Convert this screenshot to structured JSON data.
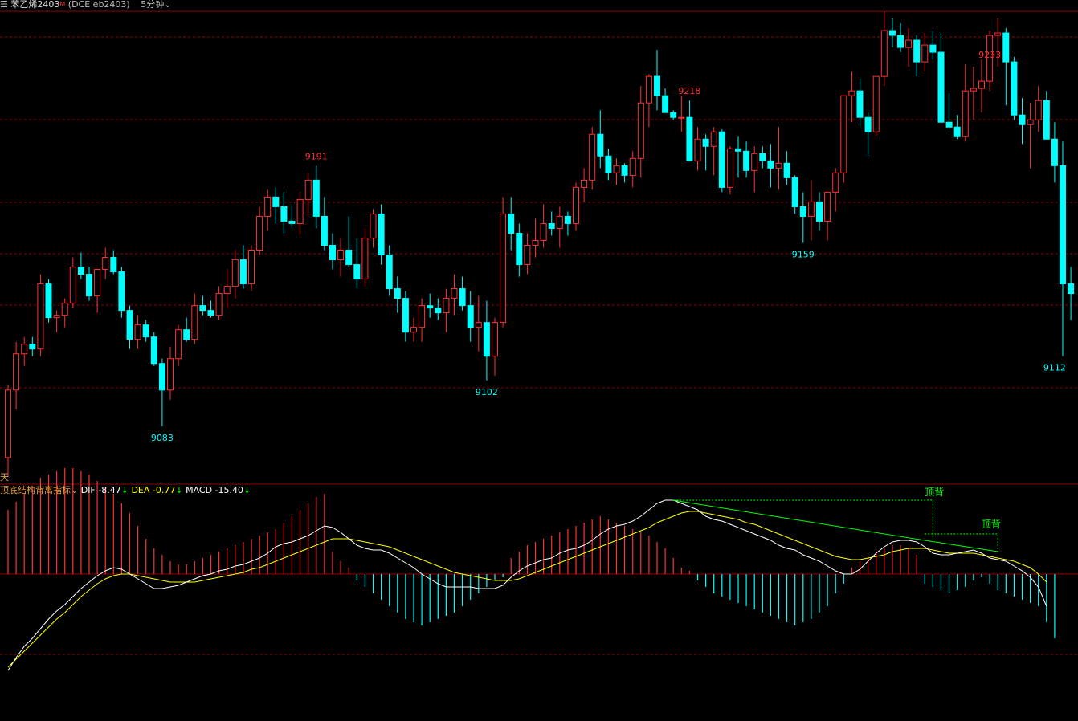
{
  "header": {
    "instrument": "苯乙烯2403",
    "mark": "M",
    "exchange_code": "(DCE  eb2403)",
    "period": "5分钟"
  },
  "days_label": "天",
  "macd_panel": {
    "indicator_name": "顶底结构背离指标",
    "dif_label": "DIF -8.47",
    "dea_label": "DEA -0.77",
    "macd_label": "MACD -15.40",
    "down_arrow": "↓",
    "annotation_1": "顶背",
    "annotation_2": "顶背"
  },
  "colors": {
    "up": "#ff3232",
    "down": "#00ffff",
    "grid": "#8b0000",
    "dif": "#ffffff",
    "dea": "#ffff00",
    "divergence": "#00ff00"
  },
  "chart_data": {
    "type": "candlestick",
    "ylim": [
      9060,
      9255
    ],
    "price_labels": [
      {
        "index": 38,
        "value": 9191,
        "kind": "high"
      },
      {
        "index": 84,
        "value": 9218,
        "kind": "high"
      },
      {
        "index": 121,
        "value": 9233,
        "kind": "high"
      },
      {
        "index": 19,
        "value": 9083,
        "kind": "low"
      },
      {
        "index": 59,
        "value": 9102,
        "kind": "low"
      },
      {
        "index": 98,
        "value": 9159,
        "kind": "low"
      },
      {
        "index": 129,
        "value": 9112,
        "kind": "low"
      }
    ],
    "candles": [
      [
        9070,
        9100,
        9062,
        9098
      ],
      [
        9098,
        9118,
        9090,
        9113
      ],
      [
        9113,
        9120,
        9108,
        9117
      ],
      [
        9117,
        9120,
        9112,
        9115
      ],
      [
        9115,
        9146,
        9112,
        9142
      ],
      [
        9142,
        9144,
        9126,
        9128
      ],
      [
        9128,
        9131,
        9122,
        9129
      ],
      [
        9129,
        9136,
        9124,
        9134
      ],
      [
        9134,
        9153,
        9132,
        9149
      ],
      [
        9149,
        9155,
        9144,
        9146
      ],
      [
        9146,
        9149,
        9135,
        9137
      ],
      [
        9137,
        9148,
        9130,
        9148
      ],
      [
        9148,
        9157,
        9144,
        9153
      ],
      [
        9153,
        9156,
        9146,
        9147
      ],
      [
        9147,
        9149,
        9128,
        9131
      ],
      [
        9131,
        9133,
        9115,
        9119
      ],
      [
        9119,
        9129,
        9115,
        9125
      ],
      [
        9125,
        9127,
        9118,
        9120
      ],
      [
        9120,
        9122,
        9108,
        9109
      ],
      [
        9109,
        9111,
        9083,
        9098
      ],
      [
        9098,
        9116,
        9094,
        9111
      ],
      [
        9111,
        9125,
        9108,
        9123
      ],
      [
        9123,
        9128,
        9118,
        9119
      ],
      [
        9119,
        9138,
        9117,
        9133
      ],
      [
        9133,
        9137,
        9129,
        9131
      ],
      [
        9131,
        9135,
        9128,
        9129
      ],
      [
        9129,
        9141,
        9127,
        9138
      ],
      [
        9138,
        9148,
        9132,
        9141
      ],
      [
        9141,
        9156,
        9136,
        9152
      ],
      [
        9152,
        9158,
        9140,
        9142
      ],
      [
        9142,
        9158,
        9139,
        9156
      ],
      [
        9156,
        9174,
        9154,
        9170
      ],
      [
        9170,
        9181,
        9164,
        9178
      ],
      [
        9178,
        9182,
        9167,
        9174
      ],
      [
        9174,
        9180,
        9163,
        9168
      ],
      [
        9168,
        9175,
        9165,
        9167
      ],
      [
        9167,
        9180,
        9162,
        9177
      ],
      [
        9177,
        9188,
        9170,
        9185
      ],
      [
        9185,
        9191,
        9165,
        9170
      ],
      [
        9170,
        9178,
        9156,
        9158
      ],
      [
        9158,
        9163,
        9148,
        9152
      ],
      [
        9152,
        9161,
        9145,
        9156
      ],
      [
        9156,
        9170,
        9149,
        9150
      ],
      [
        9150,
        9161,
        9140,
        9144
      ],
      [
        9144,
        9165,
        9141,
        9161
      ],
      [
        9161,
        9173,
        9157,
        9171
      ],
      [
        9171,
        9175,
        9150,
        9154
      ],
      [
        9154,
        9158,
        9137,
        9140
      ],
      [
        9140,
        9145,
        9130,
        9136
      ],
      [
        9136,
        9139,
        9118,
        9122
      ],
      [
        9122,
        9128,
        9118,
        9124
      ],
      [
        9124,
        9136,
        9118,
        9133
      ],
      [
        9133,
        9138,
        9128,
        9132
      ],
      [
        9132,
        9136,
        9127,
        9130
      ],
      [
        9130,
        9140,
        9122,
        9136
      ],
      [
        9136,
        9146,
        9129,
        9140
      ],
      [
        9140,
        9145,
        9131,
        9133
      ],
      [
        9133,
        9139,
        9118,
        9124
      ],
      [
        9124,
        9137,
        9114,
        9126
      ],
      [
        9126,
        9135,
        9102,
        9112
      ],
      [
        9112,
        9128,
        9104,
        9126
      ],
      [
        9126,
        9178,
        9124,
        9171
      ],
      [
        9171,
        9178,
        9156,
        9163
      ],
      [
        9163,
        9167,
        9145,
        9150
      ],
      [
        9150,
        9163,
        9146,
        9158
      ],
      [
        9158,
        9169,
        9153,
        9160
      ],
      [
        9160,
        9175,
        9157,
        9167
      ],
      [
        9167,
        9172,
        9162,
        9165
      ],
      [
        9165,
        9174,
        9157,
        9170
      ],
      [
        9170,
        9172,
        9162,
        9167
      ],
      [
        9167,
        9184,
        9164,
        9182
      ],
      [
        9182,
        9190,
        9176,
        9185
      ],
      [
        9185,
        9207,
        9181,
        9204
      ],
      [
        9204,
        9214,
        9190,
        9195
      ],
      [
        9195,
        9198,
        9185,
        9188
      ],
      [
        9188,
        9194,
        9183,
        9191
      ],
      [
        9191,
        9192,
        9184,
        9187
      ],
      [
        9187,
        9197,
        9182,
        9194
      ],
      [
        9194,
        9224,
        9186,
        9217
      ],
      [
        9217,
        9229,
        9207,
        9228
      ],
      [
        9228,
        9239,
        9214,
        9220
      ],
      [
        9220,
        9223,
        9213,
        9213
      ],
      [
        9213,
        9214,
        9210,
        9211
      ],
      [
        9211,
        9220,
        9205,
        9211
      ],
      [
        9211,
        9218,
        9200,
        9193
      ],
      [
        9193,
        9207,
        9189,
        9202
      ],
      [
        9202,
        9204,
        9189,
        9199
      ],
      [
        9199,
        9207,
        9187,
        9205
      ],
      [
        9205,
        9206,
        9180,
        9182
      ],
      [
        9182,
        9199,
        9179,
        9198
      ],
      [
        9198,
        9203,
        9186,
        9197
      ],
      [
        9197,
        9201,
        9186,
        9189
      ],
      [
        9189,
        9199,
        9180,
        9196
      ],
      [
        9196,
        9199,
        9190,
        9193
      ],
      [
        9193,
        9200,
        9182,
        9190
      ],
      [
        9190,
        9207,
        9181,
        9192
      ],
      [
        9192,
        9197,
        9183,
        9186
      ],
      [
        9186,
        9187,
        9171,
        9174
      ],
      [
        9174,
        9180,
        9159,
        9170
      ],
      [
        9170,
        9185,
        9160,
        9176
      ],
      [
        9176,
        9180,
        9164,
        9168
      ],
      [
        9168,
        9180,
        9160,
        9180
      ],
      [
        9180,
        9190,
        9172,
        9188
      ],
      [
        9188,
        9209,
        9184,
        9220
      ],
      [
        9220,
        9230,
        9209,
        9222
      ],
      [
        9222,
        9227,
        9207,
        9211
      ],
      [
        9211,
        9213,
        9195,
        9205
      ],
      [
        9205,
        9228,
        9203,
        9228
      ],
      [
        9228,
        9255,
        9224,
        9247
      ],
      [
        9247,
        9252,
        9240,
        9245
      ],
      [
        9245,
        9250,
        9238,
        9240
      ],
      [
        9240,
        9248,
        9232,
        9243
      ],
      [
        9243,
        9245,
        9228,
        9234
      ],
      [
        9234,
        9246,
        9230,
        9241
      ],
      [
        9241,
        9247,
        9235,
        9238
      ],
      [
        9238,
        9246,
        9209,
        9209
      ],
      [
        9209,
        9221,
        9206,
        9207
      ],
      [
        9207,
        9212,
        9202,
        9203
      ],
      [
        9203,
        9233,
        9201,
        9222
      ],
      [
        9222,
        9232,
        9210,
        9223
      ],
      [
        9223,
        9235,
        9213,
        9226
      ],
      [
        9226,
        9247,
        9222,
        9245
      ],
      [
        9245,
        9252,
        9232,
        9246
      ],
      [
        9246,
        9248,
        9216,
        9234
      ],
      [
        9234,
        9236,
        9210,
        9212
      ],
      [
        9212,
        9219,
        9200,
        9208
      ],
      [
        9208,
        9217,
        9190,
        9210
      ],
      [
        9210,
        9224,
        9205,
        9218
      ],
      [
        9218,
        9222,
        9202,
        9202
      ],
      [
        9202,
        9209,
        9184,
        9191
      ],
      [
        9191,
        9201,
        9112,
        9142
      ],
      [
        9142,
        9149,
        9127,
        9138
      ]
    ],
    "macd": {
      "dif": [
        -60,
        -52,
        -45,
        -40,
        -34,
        -28,
        -23,
        -19,
        -14,
        -9,
        -5,
        -1,
        2,
        4,
        3,
        0,
        -3,
        -6,
        -9,
        -9,
        -8,
        -7,
        -5,
        -3,
        -1,
        0,
        2,
        3,
        5,
        6,
        8,
        10,
        13,
        17,
        19,
        20,
        22,
        24,
        27,
        30,
        29,
        26,
        22,
        18,
        16,
        15,
        15,
        13,
        10,
        7,
        4,
        0,
        -3,
        -6,
        -8,
        -8,
        -8,
        -8,
        -9,
        -9,
        -9,
        -7,
        -2,
        2,
        5,
        7,
        9,
        10,
        13,
        15,
        16,
        18,
        21,
        25,
        28,
        30,
        31,
        33,
        36,
        40,
        44,
        46,
        46,
        44,
        42,
        40,
        36,
        34,
        33,
        31,
        29,
        27,
        25,
        23,
        21,
        18,
        16,
        15,
        12,
        10,
        8,
        5,
        2,
        0,
        0,
        3,
        8,
        13,
        17,
        20,
        21,
        21,
        20,
        17,
        13,
        12,
        12,
        13,
        14,
        15,
        13,
        10,
        9,
        8,
        5,
        2,
        -2,
        -8,
        -20
      ],
      "dea": [
        -58,
        -53,
        -48,
        -43,
        -38,
        -33,
        -28,
        -24,
        -19,
        -14,
        -10,
        -6,
        -3,
        -1,
        0,
        0,
        -1,
        -2,
        -3,
        -4,
        -5,
        -5,
        -5,
        -5,
        -4,
        -3,
        -2,
        -1,
        0,
        1,
        3,
        4,
        6,
        8,
        10,
        12,
        14,
        16,
        18,
        20,
        22,
        22,
        22,
        21,
        20,
        19,
        18,
        17,
        15,
        13,
        11,
        9,
        7,
        5,
        3,
        1,
        0,
        -1,
        -2,
        -3,
        -4,
        -4,
        -4,
        -3,
        -1,
        1,
        3,
        5,
        7,
        9,
        11,
        13,
        15,
        17,
        19,
        21,
        23,
        25,
        27,
        29,
        32,
        34,
        36,
        38,
        39,
        39,
        38,
        37,
        36,
        35,
        34,
        32,
        31,
        29,
        27,
        25,
        23,
        21,
        19,
        17,
        15,
        13,
        11,
        10,
        9,
        9,
        10,
        11,
        12,
        14,
        15,
        16,
        16,
        16,
        15,
        14,
        13,
        13,
        13,
        13,
        12,
        11,
        10,
        9,
        8,
        6,
        4,
        0,
        -5
      ],
      "hist": [
        40,
        45,
        50,
        55,
        60,
        62,
        64,
        66,
        66,
        64,
        62,
        58,
        54,
        50,
        44,
        38,
        30,
        22,
        16,
        12,
        8,
        6,
        6,
        8,
        10,
        12,
        14,
        16,
        18,
        20,
        22,
        24,
        26,
        28,
        32,
        36,
        40,
        44,
        48,
        50,
        14,
        8,
        4,
        -4,
        -8,
        -12,
        -16,
        -20,
        -24,
        -28,
        -30,
        -32,
        -30,
        -28,
        -26,
        -24,
        -20,
        -16,
        -12,
        -8,
        -4,
        -2,
        10,
        14,
        18,
        20,
        22,
        24,
        26,
        28,
        30,
        32,
        34,
        36,
        34,
        32,
        30,
        28,
        26,
        24,
        20,
        16,
        10,
        4,
        2,
        -4,
        -8,
        -12,
        -14,
        -16,
        -18,
        -20,
        -22,
        -24,
        -26,
        -28,
        -30,
        -32,
        -30,
        -28,
        -24,
        -20,
        -12,
        -6,
        4,
        8,
        10,
        14,
        16,
        18,
        18,
        16,
        12,
        -6,
        -8,
        -10,
        -12,
        -10,
        -8,
        -4,
        -2,
        -6,
        -10,
        -12,
        -14,
        -16,
        -18,
        -20,
        -30,
        -40
      ]
    }
  }
}
